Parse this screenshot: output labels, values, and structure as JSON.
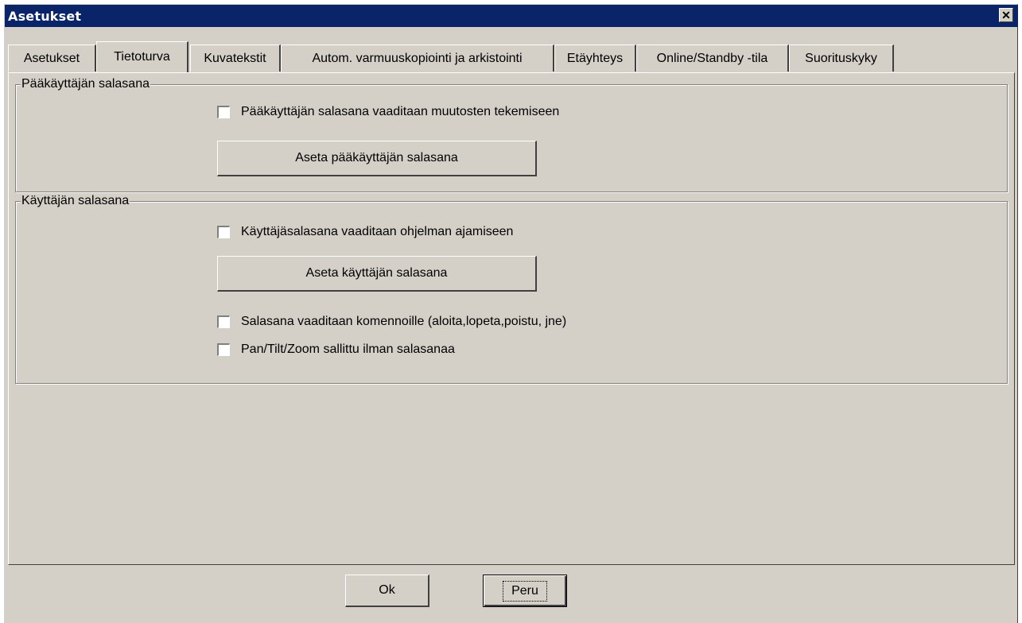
{
  "window": {
    "title": "Asetukset",
    "close_symbol": "✕"
  },
  "tabs": [
    {
      "label": "Asetukset",
      "active": false
    },
    {
      "label": "Tietoturva",
      "active": true
    },
    {
      "label": "Kuvatekstit",
      "active": false
    },
    {
      "label": "Autom. varmuuskopiointi ja arkistointi",
      "active": false
    },
    {
      "label": "Etäyhteys",
      "active": false
    },
    {
      "label": "Online/Standby -tila",
      "active": false
    },
    {
      "label": "Suorituskyky",
      "active": false
    }
  ],
  "admin_group": {
    "legend": "Pääkäyttäjän salasana",
    "checkbox_label": "Pääkäyttäjän salasana vaaditaan muutosten tekemiseen",
    "checkbox_checked": false,
    "button_label": "Aseta pääkäyttäjän salasana"
  },
  "user_group": {
    "legend": "Käyttäjän salasana",
    "checkbox_label": "Käyttäjäsalasana vaaditaan ohjelman ajamiseen",
    "checkbox_checked": false,
    "button_label": "Aseta käyttäjän salasana",
    "commands_checkbox_label": "Salasana vaaditaan komennoille (aloita,lopeta,poistu, jne)",
    "commands_checkbox_checked": false,
    "ptz_checkbox_label": "Pan/Tilt/Zoom sallittu ilman salasanaa",
    "ptz_checkbox_checked": false
  },
  "footer": {
    "ok_label": "Ok",
    "cancel_label": "Peru"
  },
  "colors": {
    "titlebar": "#0a246a",
    "face": "#d4d0c8"
  }
}
